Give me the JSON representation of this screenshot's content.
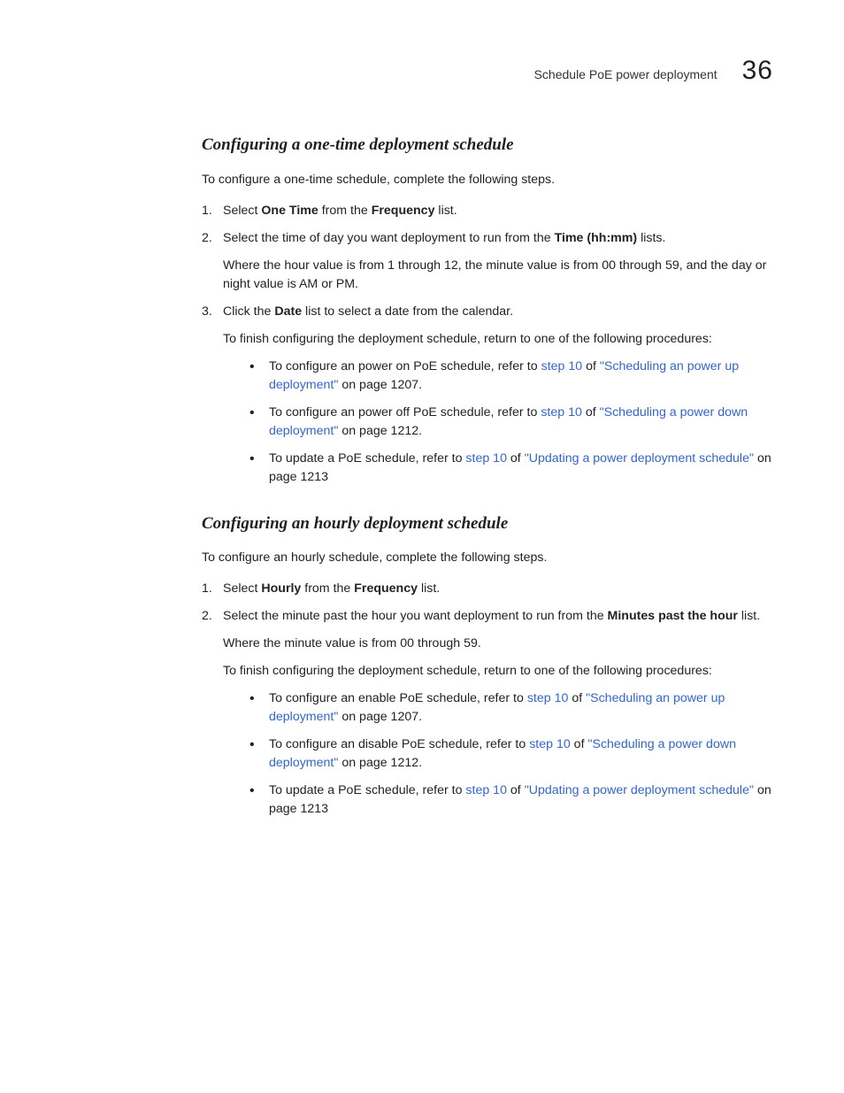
{
  "header": {
    "title": "Schedule PoE power deployment",
    "chapter": "36"
  },
  "s1": {
    "heading": "Configuring a one-time deployment schedule",
    "intro": "To configure a one-time schedule, complete the following steps.",
    "step1_a": "Select ",
    "step1_b": "One Time",
    "step1_c": " from the ",
    "step1_d": "Frequency",
    "step1_e": " list.",
    "step2_a": "Select the time of day you want deployment to run from the ",
    "step2_b": "Time (hh:mm)",
    "step2_c": " lists.",
    "step2_sub": "Where the hour value is from 1 through 12, the minute value is from 00 through 59, and the day or night value is AM or PM.",
    "step3_a": "Click the ",
    "step3_b": "Date",
    "step3_c": " list to select a date from the calendar.",
    "step3_sub": "To finish configuring the deployment schedule, return to one of the following procedures:",
    "b1_a": "To configure an power on PoE schedule, refer to ",
    "b1_link1": "step 10",
    "b1_b": " of ",
    "b1_link2": "\"Scheduling an power up deployment\"",
    "b1_c": " on page 1207.",
    "b2_a": "To configure an power off PoE schedule, refer to ",
    "b2_link1": "step 10",
    "b2_b": " of ",
    "b2_link2": "\"Scheduling a power down deployment\"",
    "b2_c": " on page 1212.",
    "b3_a": "To update a PoE schedule, refer to ",
    "b3_link1": "step 10",
    "b3_b": " of ",
    "b3_link2": "\"Updating a power deployment schedule\"",
    "b3_c": " on page 1213"
  },
  "s2": {
    "heading": "Configuring an hourly deployment schedule",
    "intro": "To configure an hourly schedule, complete the following steps.",
    "step1_a": "Select ",
    "step1_b": "Hourly",
    "step1_c": " from the ",
    "step1_d": "Frequency",
    "step1_e": " list.",
    "step2_a": "Select the minute past the hour you want deployment to run from the ",
    "step2_b": "Minutes past the hour",
    "step2_c": " list.",
    "step2_sub": "Where the minute value is from 00 through 59.",
    "step2_sub2": "To finish configuring the deployment schedule, return to one of the following procedures:",
    "b1_a": "To configure an enable PoE schedule, refer to ",
    "b1_link1": "step 10",
    "b1_b": " of ",
    "b1_link2": "\"Scheduling an power up deployment\"",
    "b1_c": " on page 1207.",
    "b2_a": "To configure an disable PoE schedule, refer to ",
    "b2_link1": "step 10",
    "b2_b": " of ",
    "b2_link2": "\"Scheduling a power down deployment\"",
    "b2_c": " on page 1212.",
    "b3_a": "To update a PoE schedule, refer to ",
    "b3_link1": "step 10",
    "b3_b": " of ",
    "b3_link2": "\"Updating a power deployment schedule\"",
    "b3_c": " on page 1213"
  }
}
